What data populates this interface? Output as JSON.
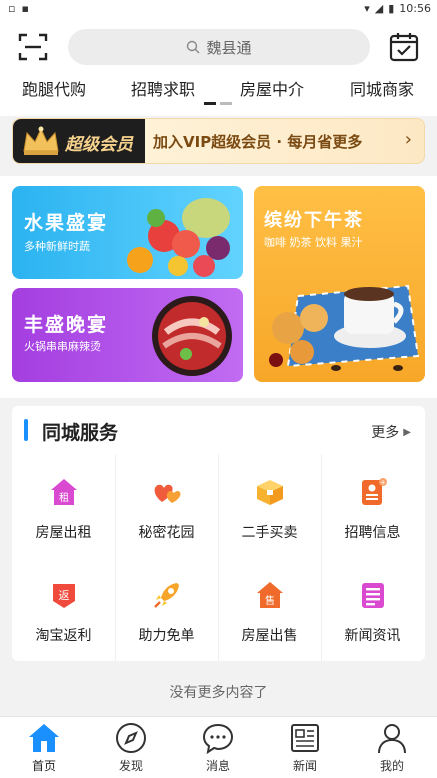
{
  "status": {
    "time": "10:56"
  },
  "search": {
    "placeholder": "魏县通"
  },
  "tabs": [
    {
      "label": "跑腿代购"
    },
    {
      "label": "招聘求职"
    },
    {
      "label": "房屋中介"
    },
    {
      "label": "同城商家"
    }
  ],
  "vip": {
    "title": "超级会员",
    "text": "加入VIP超级会员 · 每月省更多"
  },
  "promos": {
    "fruit": {
      "title": "水果盛宴",
      "subtitle": "多种新鲜时蔬"
    },
    "feast": {
      "title": "丰盛晚宴",
      "subtitle": "火锅串串麻辣烫"
    },
    "tea": {
      "title": "缤纷下午茶",
      "subtitle": "咖啡 奶茶 饮料 果汁"
    }
  },
  "services": {
    "title": "同城服务",
    "more": "更多",
    "items": [
      {
        "label": "房屋出租",
        "icon": "house-rent-icon"
      },
      {
        "label": "秘密花园",
        "icon": "hearts-icon"
      },
      {
        "label": "二手买卖",
        "icon": "box-icon"
      },
      {
        "label": "招聘信息",
        "icon": "resume-icon"
      },
      {
        "label": "淘宝返利",
        "icon": "rebate-icon"
      },
      {
        "label": "助力免单",
        "icon": "rocket-icon"
      },
      {
        "label": "房屋出售",
        "icon": "house-sale-icon"
      },
      {
        "label": "新闻资讯",
        "icon": "news-icon"
      }
    ]
  },
  "footer_note": "没有更多内容了",
  "nav": [
    {
      "label": "首页",
      "icon": "home-icon"
    },
    {
      "label": "发现",
      "icon": "compass-icon"
    },
    {
      "label": "消息",
      "icon": "message-icon"
    },
    {
      "label": "新闻",
      "icon": "news-icon"
    },
    {
      "label": "我的",
      "icon": "user-icon"
    }
  ],
  "colors": {
    "accent": "#1a90ff",
    "vip_gold": "#f6d28d",
    "tea_orange": "#f7a728"
  }
}
